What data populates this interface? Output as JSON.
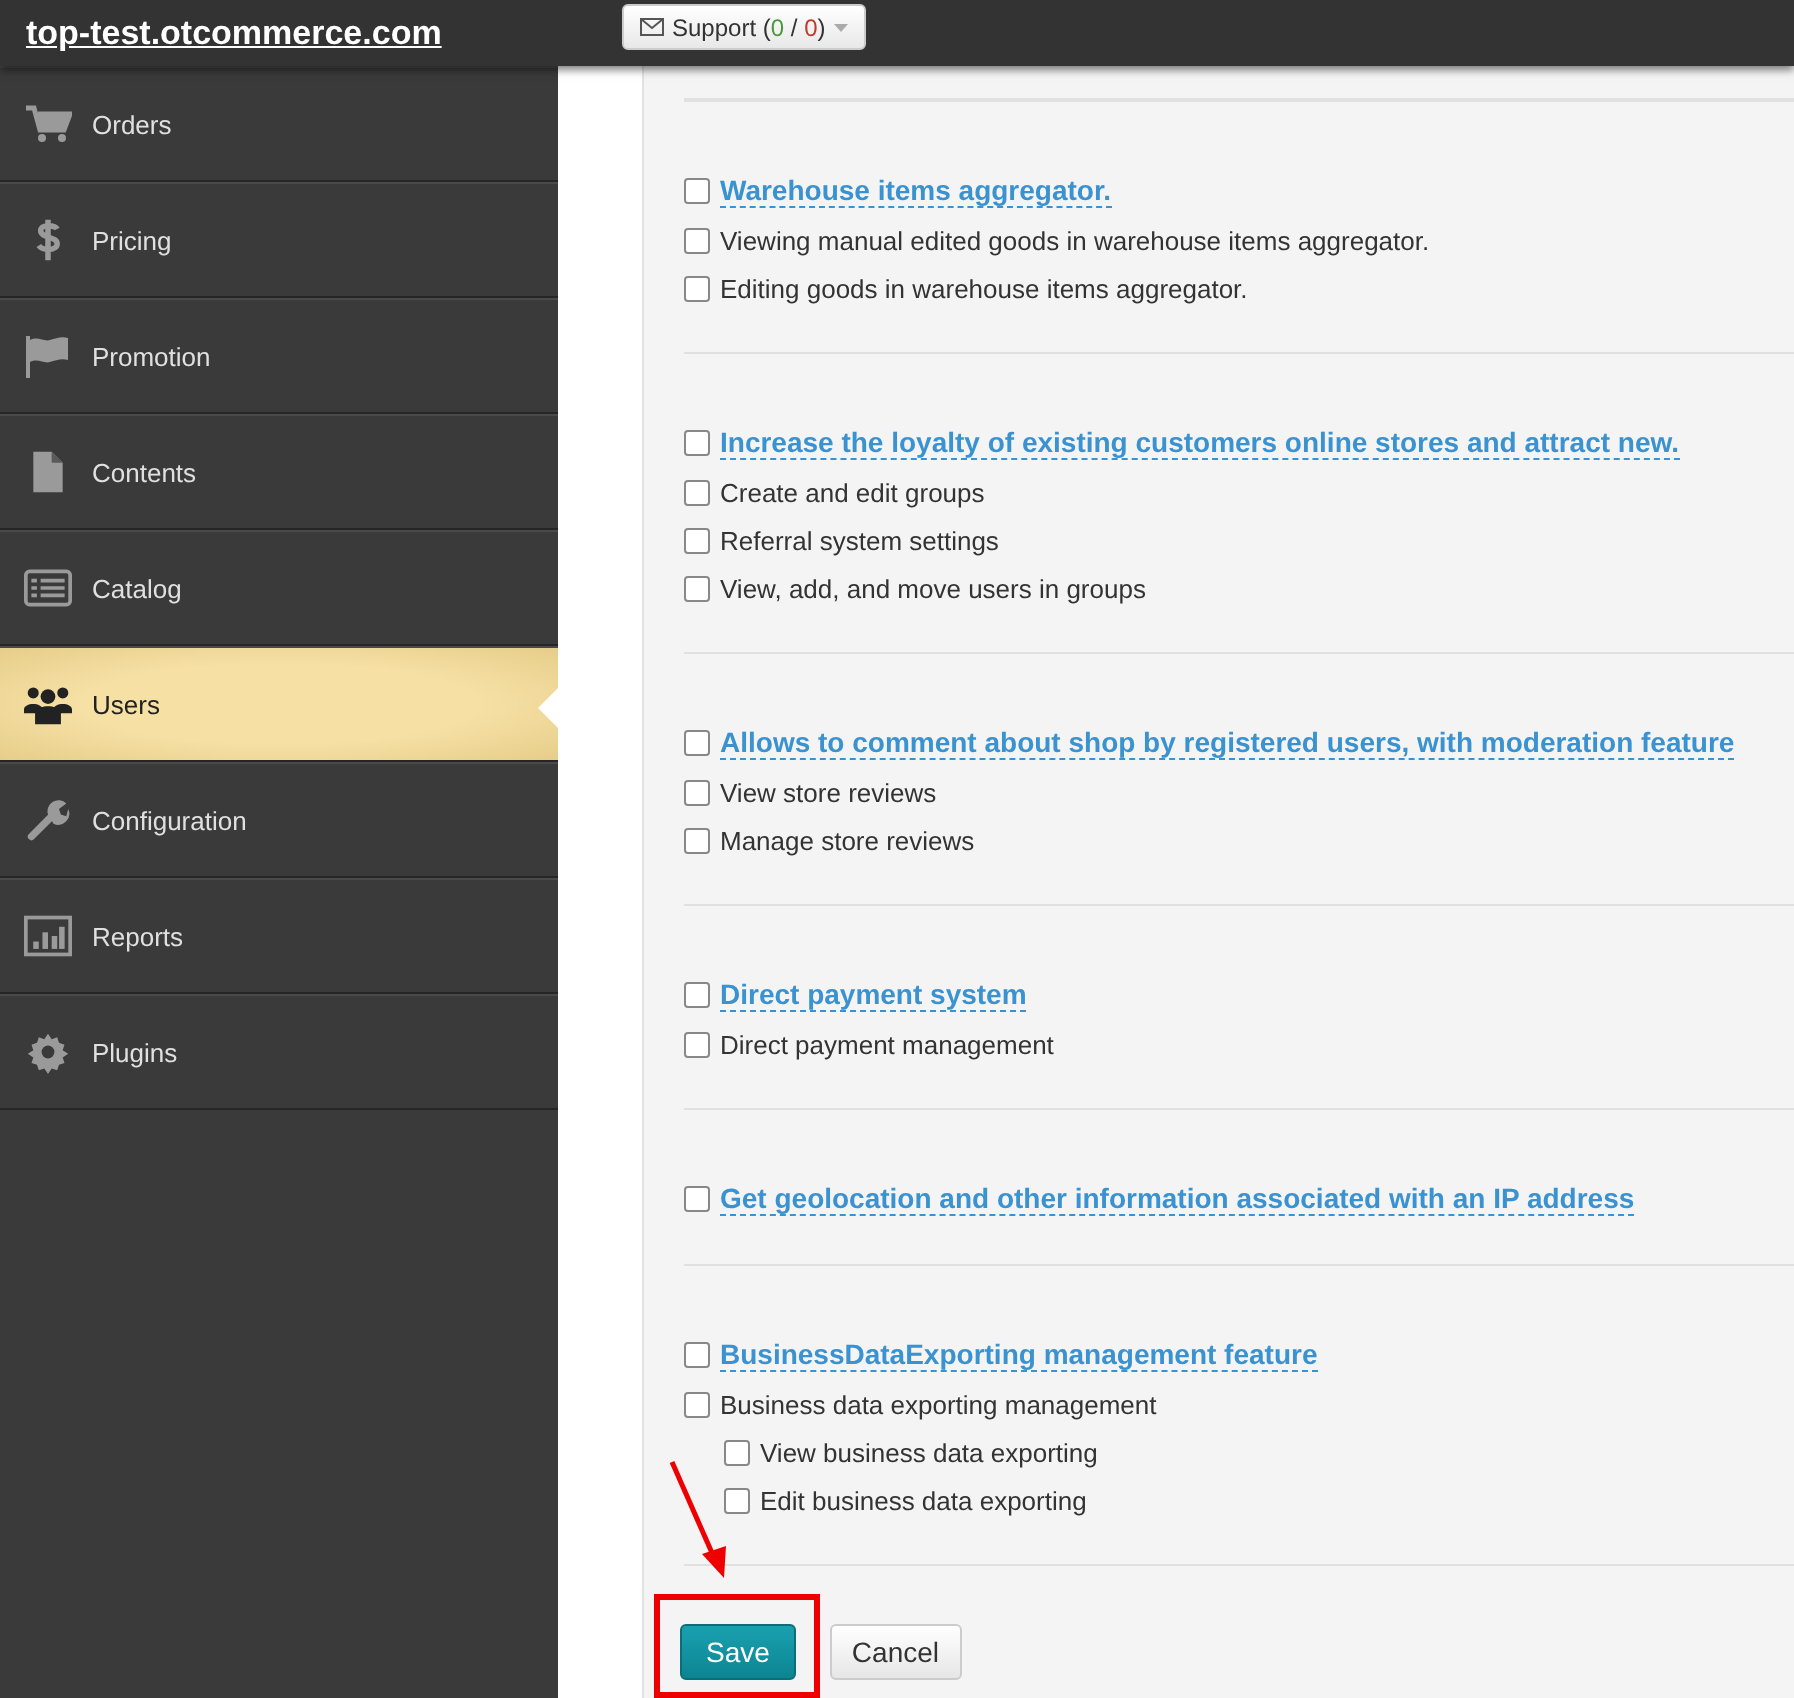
{
  "header": {
    "site_title": "top-test.otcommerce.com",
    "support_button": {
      "parts": [
        {
          "text": "Support ("
        },
        {
          "text": "0",
          "color": "#4a9a3a"
        },
        {
          "text": " / "
        },
        {
          "text": "0",
          "color": "#c0392b"
        },
        {
          "text": ")"
        }
      ]
    }
  },
  "sidebar": {
    "items": [
      {
        "label": "Orders",
        "selected": false
      },
      {
        "label": "Pricing",
        "selected": false
      },
      {
        "label": "Promotion",
        "selected": false
      },
      {
        "label": "Contents",
        "selected": false
      },
      {
        "label": "Catalog",
        "selected": false
      },
      {
        "label": "Users",
        "selected": true
      },
      {
        "label": "Configuration",
        "selected": false
      },
      {
        "label": "Reports",
        "selected": false
      },
      {
        "label": "Plugins",
        "selected": false
      }
    ]
  },
  "sections": [
    {
      "title": "Warehouse items aggregator.",
      "checked": false,
      "items": [
        {
          "label": "Viewing manual edited goods in warehouse items aggregator.",
          "checked": false
        },
        {
          "label": "Editing goods in warehouse items aggregator.",
          "checked": false
        }
      ]
    },
    {
      "title": "Increase the loyalty of existing customers online stores and attract new.",
      "checked": false,
      "items": [
        {
          "label": "Create and edit groups",
          "checked": false
        },
        {
          "label": "Referral system settings",
          "checked": false
        },
        {
          "label": "View, add, and move users in groups",
          "checked": false
        }
      ]
    },
    {
      "title": "Allows to comment about shop by registered users, with moderation feature",
      "checked": false,
      "items": [
        {
          "label": "View store reviews",
          "checked": false
        },
        {
          "label": "Manage store reviews",
          "checked": false
        }
      ]
    },
    {
      "title": "Direct payment system",
      "checked": false,
      "items": [
        {
          "label": "Direct payment management",
          "checked": false
        }
      ]
    },
    {
      "title": "Get geolocation and other information associated with an IP address",
      "checked": false
    },
    {
      "title": "BusinessDataExporting management feature",
      "checked": false,
      "items": [
        {
          "label": "Business data exporting management",
          "checked": false,
          "children": [
            {
              "label": "View business data exporting",
              "checked": false
            },
            {
              "label": "Edit business data exporting",
              "checked": false
            }
          ]
        }
      ]
    }
  ],
  "buttons": {
    "save": "Save",
    "cancel": "Cancel"
  }
}
